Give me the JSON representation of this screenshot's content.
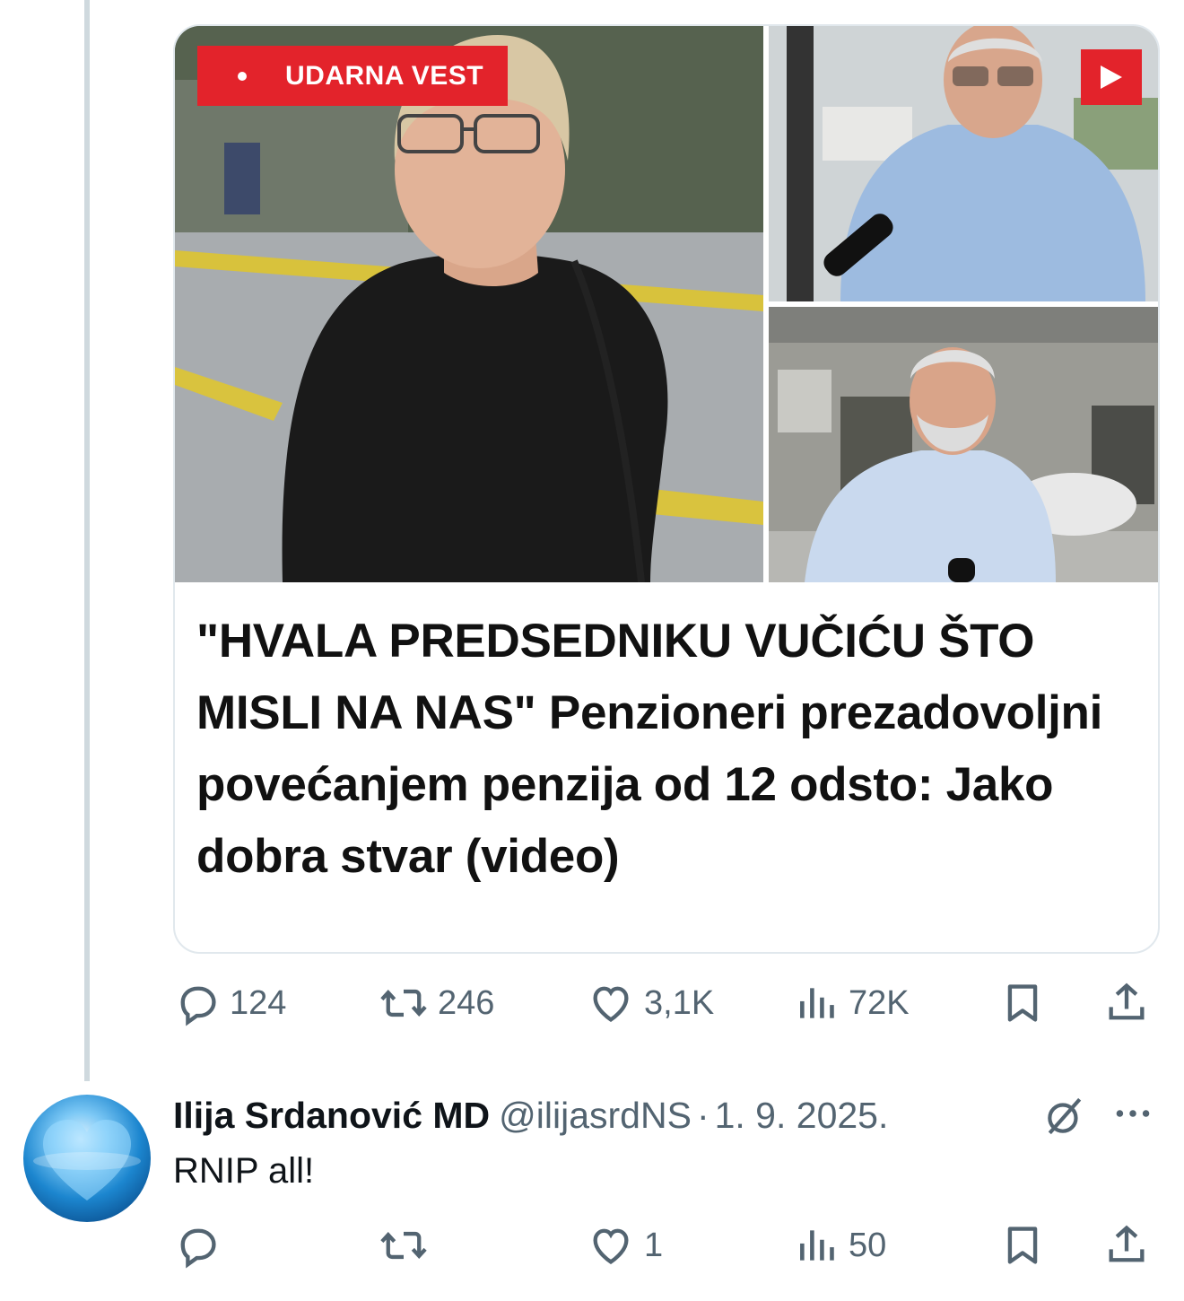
{
  "post": {
    "badge_label": "UDARNA VEST",
    "headline": "\"HVALA PREDSEDNIKU VUČIĆU ŠTO MISLI NA NAS\" Penzioneri prezadovoljni povećanjem penzija od 12 odsto: Jako dobra stvar (video)",
    "stats": {
      "replies": "124",
      "reposts": "246",
      "likes": "3,1K",
      "views": "72K"
    }
  },
  "reply": {
    "author_name": "Ilija Srdanović MD",
    "handle": "@ilijasrdNS",
    "separator": "·",
    "date": "1. 9. 2025.",
    "text": "RNIP all!",
    "stats": {
      "replies": "",
      "reposts": "",
      "likes": "1",
      "views": "50"
    }
  },
  "icons": [
    "reply-icon",
    "repost-icon",
    "like-icon",
    "views-icon",
    "bookmark-icon",
    "share-icon",
    "grok-icon",
    "more-icon",
    "play-icon"
  ],
  "colors": {
    "badge_red": "#e3232b",
    "icon_gray": "#536471",
    "text": "#0f1419",
    "thread_line": "#cfd9de"
  }
}
